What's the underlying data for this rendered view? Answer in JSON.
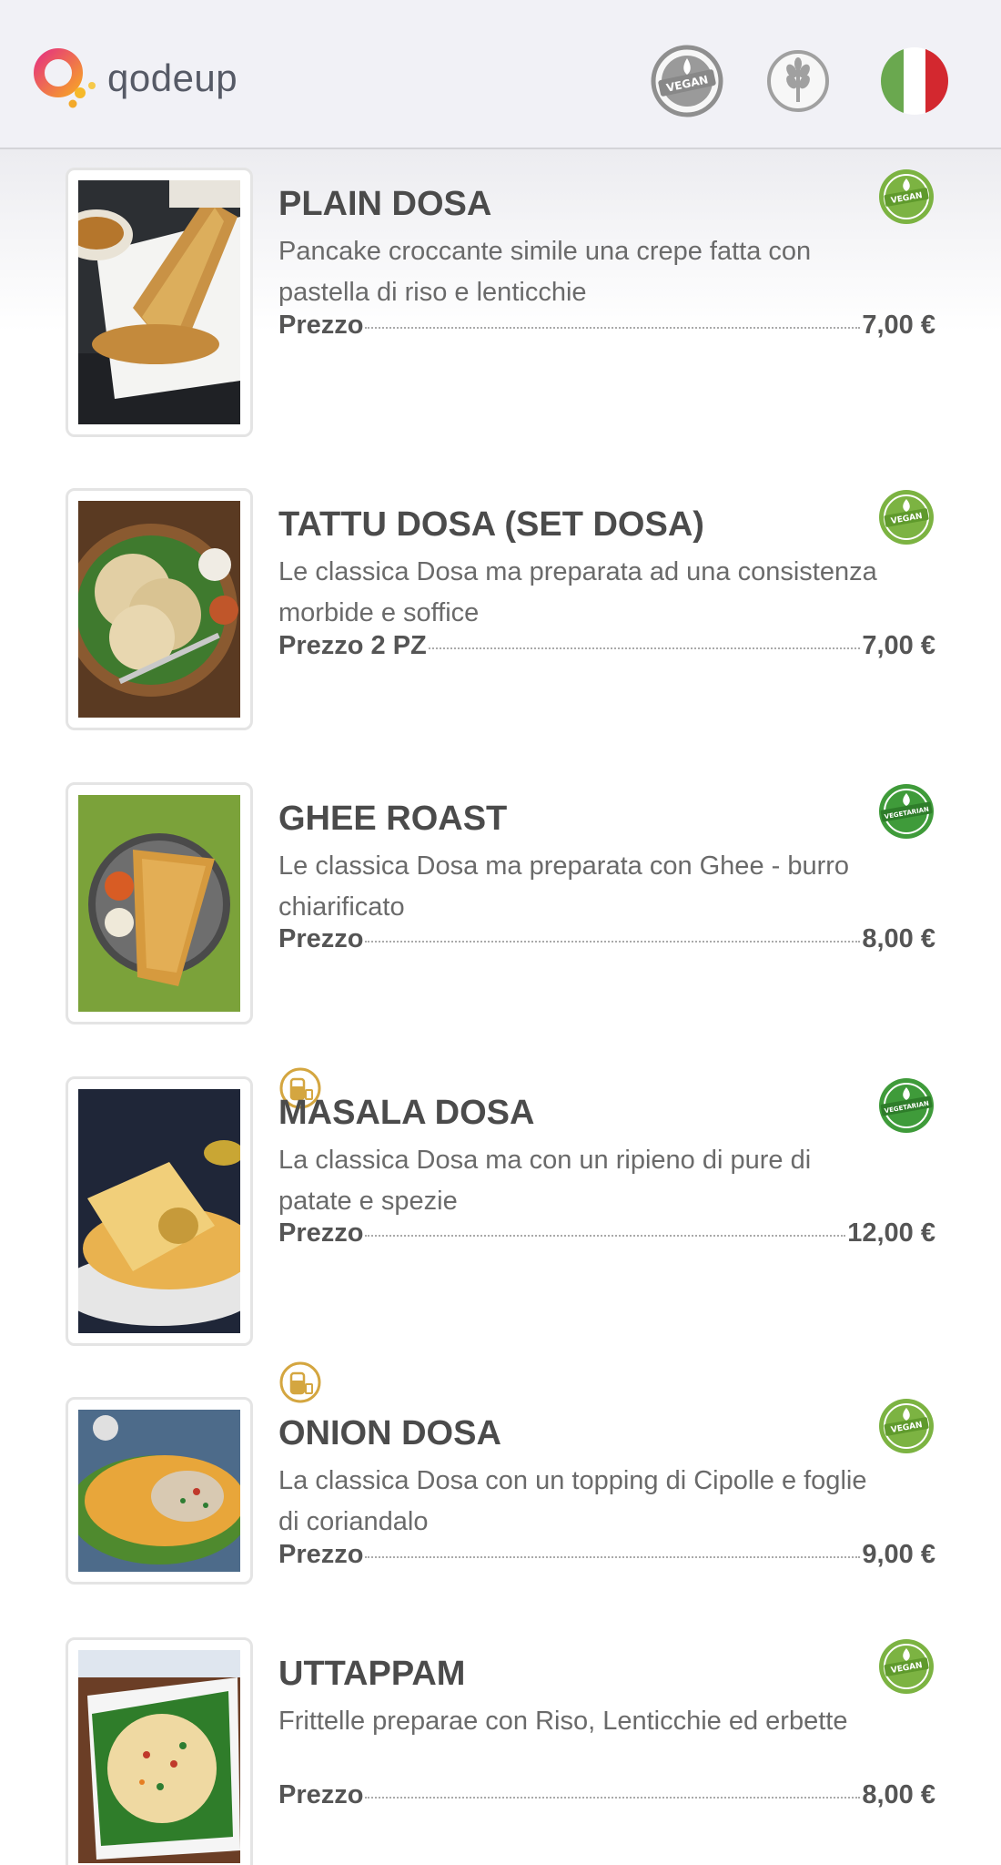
{
  "header": {
    "brand": "qodeup",
    "filter_vegan_label": "VEGAN",
    "language": "Italiano"
  },
  "menu": {
    "items": [
      {
        "name": "PLAIN DOSA",
        "description": "Pancake croccante simile una crepe fatta con pastella di riso e lenticchie",
        "price_label": "Prezzo",
        "price": "7,00 €",
        "diet_badge": "VEGAN",
        "allergen_icon": ""
      },
      {
        "name": "TATTU DOSA (SET DOSA)",
        "description": "Le classica Dosa ma preparata ad una consistenza morbide e soffice",
        "price_label": "Prezzo 2 PZ",
        "price": "7,00 €",
        "diet_badge": "VEGAN",
        "allergen_icon": ""
      },
      {
        "name": "GHEE ROAST",
        "description": "Le classica Dosa ma preparata con Ghee - burro chiarificato",
        "price_label": "Prezzo",
        "price": "8,00 €",
        "diet_badge": "VEGETARIAN",
        "allergen_icon": "milk-icon"
      },
      {
        "name": "MASALA DOSA",
        "description": "La classica Dosa ma con un ripieno di pure di patate e spezie",
        "price_label": "Prezzo",
        "price": "12,00 €",
        "diet_badge": "VEGETARIAN",
        "allergen_icon": "milk-icon"
      },
      {
        "name": "ONION DOSA",
        "description": "La classica Dosa con un topping di Cipolle e foglie di coriandalo",
        "price_label": "Prezzo",
        "price": "9,00 €",
        "diet_badge": "VEGAN",
        "allergen_icon": ""
      },
      {
        "name": "UTTAPPAM",
        "description": "Frittelle preparae con Riso, Lenticchie ed erbette",
        "price_label": "Prezzo",
        "price": "8,00 €",
        "diet_badge": "VEGAN",
        "allergen_icon": ""
      }
    ]
  },
  "colors": {
    "vegan_green": "#7cb342",
    "vegetarian_green": "#3f9b3a",
    "allergen_gold": "#d4a640",
    "header_bg": "#f1f1f6",
    "logo_gradient_start": "#e6387a",
    "logo_gradient_end": "#f6b92a"
  }
}
